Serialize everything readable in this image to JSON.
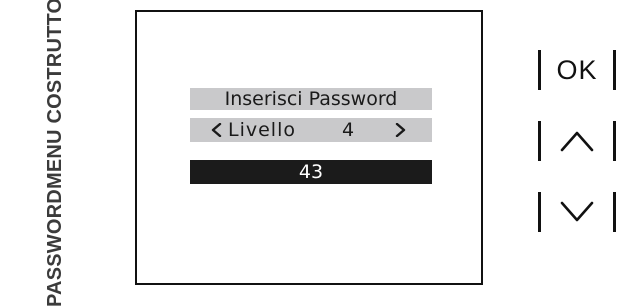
{
  "side_caption": {
    "line1": "PASSWORD",
    "line2": "MENU COSTRUTTORE"
  },
  "display": {
    "title": "Inserisci Password",
    "level_label": "Livello",
    "level_value": "4",
    "entered_value": "43",
    "left_icon": "chevron-left-icon",
    "right_icon": "chevron-right-icon"
  },
  "keys": {
    "ok_label": "OK",
    "up_icon": "chevron-up-icon",
    "down_icon": "chevron-down-icon"
  },
  "colors": {
    "highlight_bar": "#c9c9cb",
    "entry_bar": "#1b1b1b",
    "frame": "#111111"
  }
}
